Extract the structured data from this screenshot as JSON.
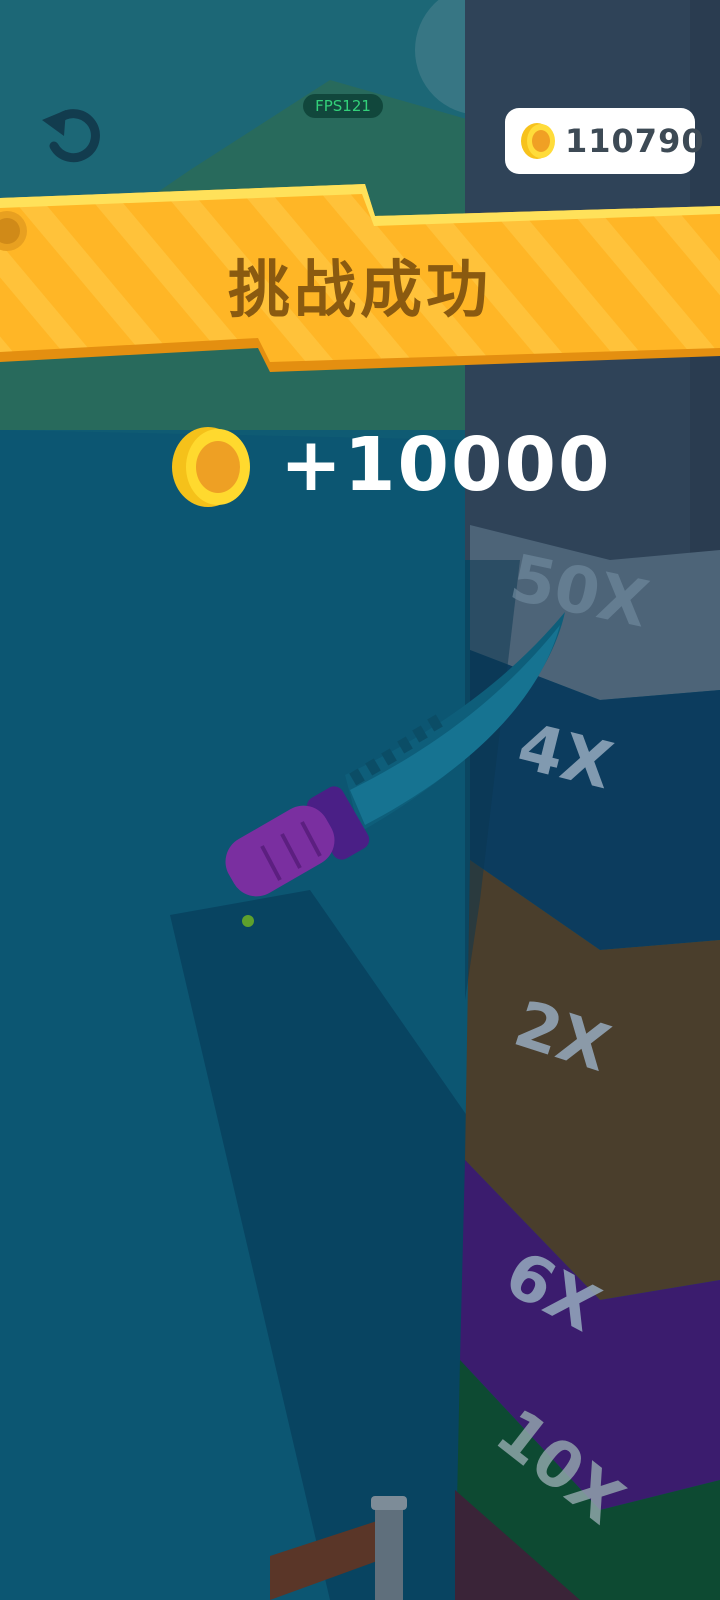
{
  "hud": {
    "fps_label": "FPS121",
    "coin_total": "110790"
  },
  "result": {
    "title": "挑战成功",
    "reward_amount": "+10000"
  },
  "tower": {
    "blocks": [
      {
        "label": "50X",
        "color": "#4d6478"
      },
      {
        "label": "4X",
        "color": "#0c3c5e"
      },
      {
        "label": "2X",
        "color": "#4a3e2c"
      },
      {
        "label": "6X",
        "color": "#3b1c6e"
      },
      {
        "label": "10X",
        "color": "#0d4a32"
      }
    ]
  },
  "colors": {
    "background": "#0f5b73",
    "banner": "#ffb626",
    "coin": "#f8c51c",
    "knife_blade": "#0e5e7a",
    "knife_handle": "#7a2fa0"
  }
}
